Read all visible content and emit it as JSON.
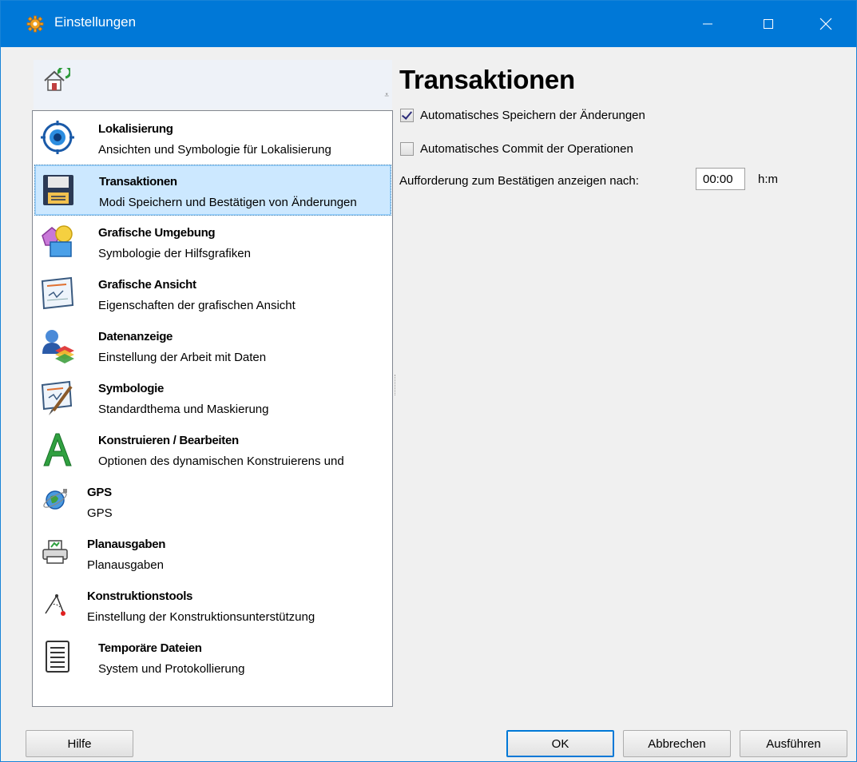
{
  "window": {
    "title": "Einstellungen",
    "accent": "#0078d7",
    "controls": {
      "minimize": "minimize-icon",
      "maximize": "maximize-icon",
      "close": "close-icon"
    }
  },
  "nav": {
    "header_icon": "home-settings-icon",
    "items": [
      {
        "title": "Lokalisierung",
        "desc": "Ansichten und Symbologie für Lokalisierung",
        "icon": "target-eye-icon"
      },
      {
        "title": "Transaktionen",
        "desc": "Modi Speichern und Bestätigen von Änderungen",
        "icon": "floppy-disk-icon",
        "selected": true
      },
      {
        "title": "Grafische Umgebung",
        "desc": "Symbologie der Hilfsgrafiken",
        "icon": "shapes-icon"
      },
      {
        "title": "Grafische Ansicht",
        "desc": "Eigenschaften der grafischen Ansicht",
        "icon": "map-view-icon"
      },
      {
        "title": "Datenanzeige",
        "desc": "Einstellung der Arbeit mit Daten",
        "icon": "user-layers-icon"
      },
      {
        "title": "Symbologie",
        "desc": "Standardthema und Maskierung",
        "icon": "map-brush-icon"
      },
      {
        "title": "Konstruieren / Bearbeiten",
        "desc": "Optionen des dynamischen Konstruierens und",
        "icon": "letter-a-icon"
      },
      {
        "title": "GPS",
        "desc": "GPS",
        "icon": "globe-satellite-icon"
      },
      {
        "title": "Planausgaben",
        "desc": "Planausgaben",
        "icon": "printer-icon"
      },
      {
        "title": "Konstruktionstools",
        "desc": "Einstellung der Konstruktionsunterstützung",
        "icon": "compass-tool-icon"
      },
      {
        "title": "Temporäre Dateien",
        "desc": "System und Protokollierung",
        "icon": "notepad-icon"
      }
    ]
  },
  "panel": {
    "title": "Transaktionen",
    "auto_save": {
      "label": "Automatisches Speichern der Änderungen",
      "checked": true
    },
    "auto_commit": {
      "label": "Automatisches Commit der Operationen",
      "checked": false
    },
    "prompt_label": "Aufforderung zum Bestätigen anzeigen nach:",
    "prompt_value": "00:00",
    "prompt_unit": "h:m"
  },
  "buttons": {
    "help": "Hilfe",
    "ok": "OK",
    "cancel": "Abbrechen",
    "apply": "Ausführen"
  }
}
